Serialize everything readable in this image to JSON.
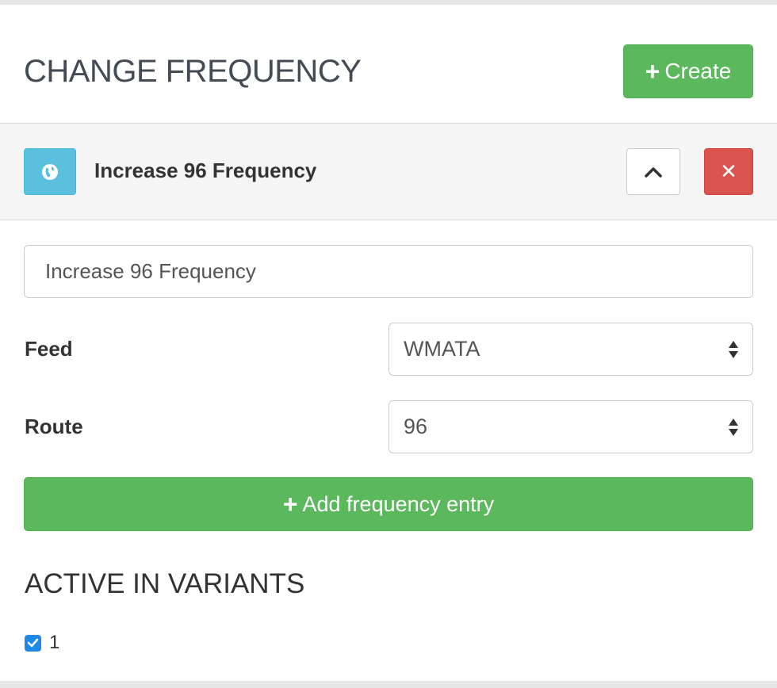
{
  "header": {
    "title": "CHANGE FREQUENCY",
    "create_label": "Create"
  },
  "panel": {
    "title": "Increase 96 Frequency",
    "icons": {
      "type": "globe-icon",
      "collapse": "chevron-up-icon",
      "delete": "close-icon"
    }
  },
  "form": {
    "name_value": "Increase 96 Frequency",
    "feed": {
      "label": "Feed",
      "value": "WMATA"
    },
    "route": {
      "label": "Route",
      "value": "96"
    },
    "add_entry_label": "Add frequency entry"
  },
  "variants": {
    "title": "ACTIVE IN VARIANTS",
    "items": [
      {
        "label": "1",
        "checked": true
      }
    ]
  },
  "colors": {
    "success": "#5cb85c",
    "info": "#5bc0de",
    "danger": "#d9534f",
    "checkbox": "#1e88e5"
  }
}
